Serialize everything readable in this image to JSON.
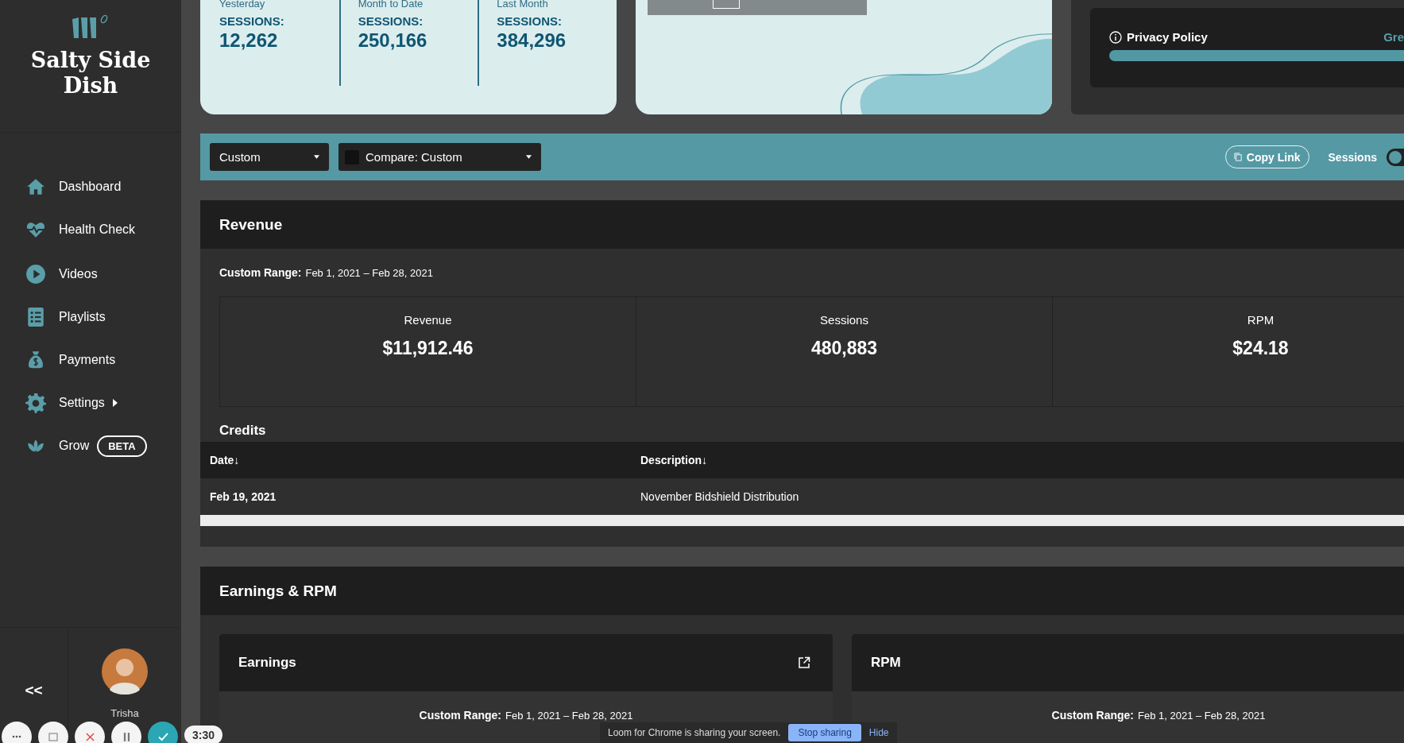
{
  "brand": {
    "name": "Salty Side Dish"
  },
  "sidebar": {
    "items": [
      {
        "label": "Dashboard",
        "selected": false
      },
      {
        "label": "Health Check",
        "selected": false
      },
      {
        "label": "Videos",
        "selected": false
      },
      {
        "label": "Playlists",
        "selected": false
      },
      {
        "label": "Payments",
        "selected": false
      },
      {
        "label": "Settings",
        "selected": false,
        "submenu": true
      },
      {
        "label": "Grow",
        "selected": false,
        "badge": "BETA"
      }
    ],
    "collapse": "<<",
    "user": "Trisha"
  },
  "session_stats": [
    {
      "period": "Yesterday",
      "label": "SESSIONS:",
      "value": "12,262"
    },
    {
      "period": "Month to Date",
      "label": "SESSIONS:",
      "value": "250,166"
    },
    {
      "period": "Last Month",
      "label": "SESSIONS:",
      "value": "384,296"
    }
  ],
  "privacy": {
    "title": "Privacy Policy",
    "status": "Gre",
    "level": 1.0
  },
  "toolbar": {
    "range": "Custom",
    "compare": "Compare: Custom",
    "copy_link": "Copy Link",
    "toggle_label": "Sessions",
    "toggle_on": false
  },
  "revenue": {
    "title": "Revenue",
    "range_label": "Custom Range:",
    "range": "Feb 1, 2021 – Feb 28, 2021",
    "metrics": [
      {
        "label": "Revenue",
        "value": "$11,912.46"
      },
      {
        "label": "Sessions",
        "value": "480,883"
      },
      {
        "label": "RPM",
        "value": "$24.18"
      }
    ],
    "credits": {
      "title": "Credits",
      "columns": [
        "Date↓",
        "Description↓"
      ],
      "rows": [
        [
          "Feb 19, 2021",
          "November Bidshield Distribution"
        ]
      ]
    }
  },
  "earnings": {
    "title": "Earnings & RPM",
    "cards": [
      {
        "title": "Earnings",
        "range_label": "Custom Range:",
        "range": "Feb 1, 2021 – Feb 28, 2021",
        "external": true
      },
      {
        "title": "RPM",
        "range_label": "Custom Range:",
        "range": "Feb 1, 2021 – Feb 28, 2021"
      }
    ]
  },
  "recorder": {
    "timer": "3:30",
    "message": "Loom for Chrome is sharing your screen.",
    "stop": "Stop sharing",
    "hide": "Hide"
  }
}
